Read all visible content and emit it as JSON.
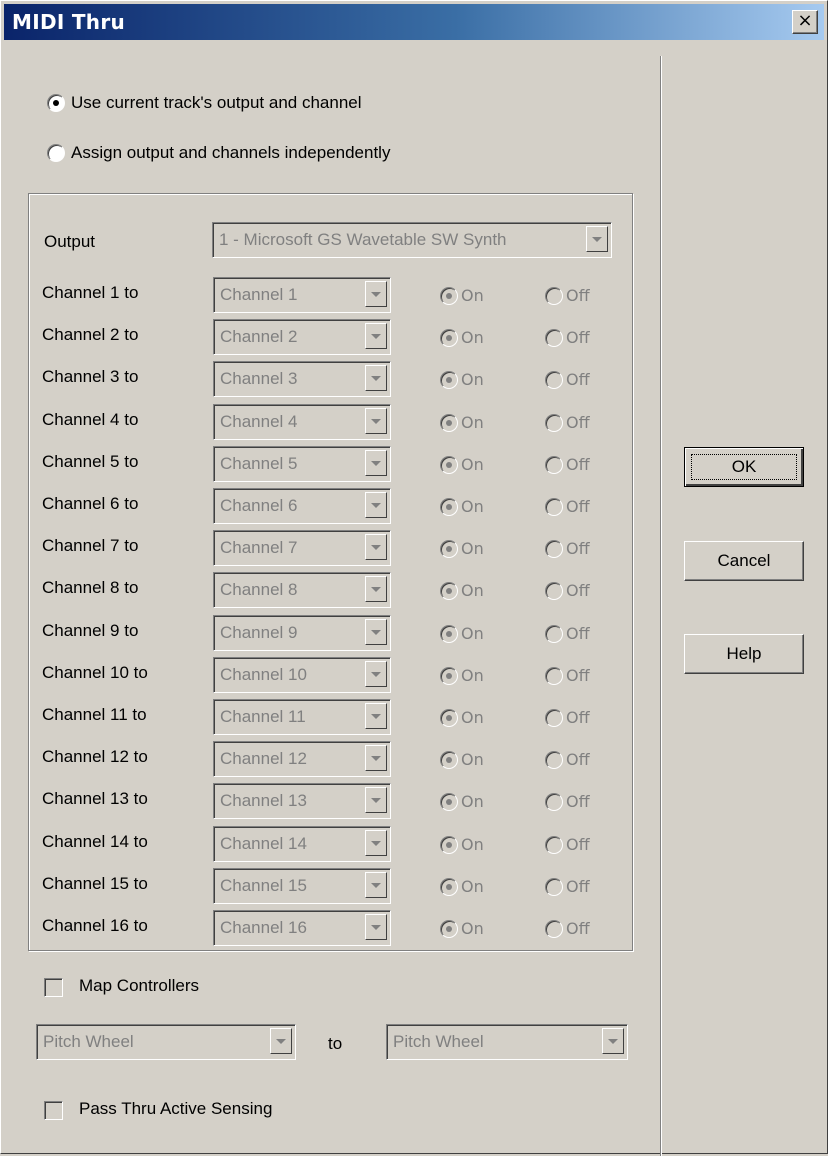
{
  "window": {
    "title": "MIDI Thru",
    "close_glyph": "×"
  },
  "mode": {
    "option_current": "Use current track's output and channel",
    "option_independent": "Assign output and channels independently",
    "selected": "current"
  },
  "output": {
    "label": "Output",
    "value": "1 - Microsoft GS Wavetable SW Synth"
  },
  "channels": [
    {
      "label": "Channel 1 to",
      "value": "Channel 1",
      "on": "On",
      "off": "Off"
    },
    {
      "label": "Channel 2 to",
      "value": "Channel 2",
      "on": "On",
      "off": "Off"
    },
    {
      "label": "Channel 3 to",
      "value": "Channel 3",
      "on": "On",
      "off": "Off"
    },
    {
      "label": "Channel 4 to",
      "value": "Channel 4",
      "on": "On",
      "off": "Off"
    },
    {
      "label": "Channel 5 to",
      "value": "Channel 5",
      "on": "On",
      "off": "Off"
    },
    {
      "label": "Channel 6 to",
      "value": "Channel 6",
      "on": "On",
      "off": "Off"
    },
    {
      "label": "Channel 7 to",
      "value": "Channel 7",
      "on": "On",
      "off": "Off"
    },
    {
      "label": "Channel 8 to",
      "value": "Channel 8",
      "on": "On",
      "off": "Off"
    },
    {
      "label": "Channel 9 to",
      "value": "Channel 9",
      "on": "On",
      "off": "Off"
    },
    {
      "label": "Channel 10 to",
      "value": "Channel 10",
      "on": "On",
      "off": "Off"
    },
    {
      "label": "Channel 11 to",
      "value": "Channel 11",
      "on": "On",
      "off": "Off"
    },
    {
      "label": "Channel 12 to",
      "value": "Channel 12",
      "on": "On",
      "off": "Off"
    },
    {
      "label": "Channel 13 to",
      "value": "Channel 13",
      "on": "On",
      "off": "Off"
    },
    {
      "label": "Channel 14 to",
      "value": "Channel 14",
      "on": "On",
      "off": "Off"
    },
    {
      "label": "Channel 15 to",
      "value": "Channel 15",
      "on": "On",
      "off": "Off"
    },
    {
      "label": "Channel 16 to",
      "value": "Channel 16",
      "on": "On",
      "off": "Off"
    }
  ],
  "controllers": {
    "map_label": "Map Controllers",
    "map_checked": false,
    "from_value": "Pitch Wheel",
    "to_label": "to",
    "to_value": "Pitch Wheel"
  },
  "active_sensing": {
    "label": "Pass Thru Active Sensing",
    "checked": false
  },
  "buttons": {
    "ok": "OK",
    "cancel": "Cancel",
    "help": "Help"
  },
  "colors": {
    "face": "#d4d0c8",
    "title_start": "#0a246a",
    "title_end": "#a6caf0",
    "disabled_text": "#808080"
  }
}
